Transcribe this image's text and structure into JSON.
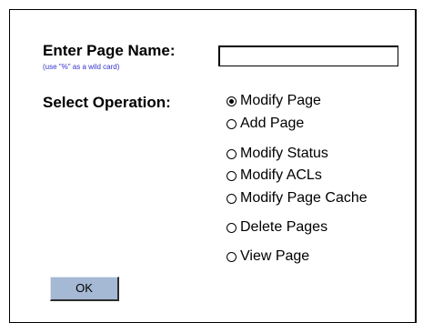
{
  "form": {
    "page_name_label": "Enter Page Name:",
    "wildcard_hint": "(use \"%\" as a wild card)",
    "page_name_value": "",
    "operation_label": "Select Operation:",
    "operations": [
      {
        "label": "Modify Page",
        "checked": true
      },
      {
        "label": "Add Page",
        "checked": false
      },
      {
        "label": "Modify Status",
        "checked": false
      },
      {
        "label": "Modify ACLs",
        "checked": false
      },
      {
        "label": "Modify Page Cache",
        "checked": false
      },
      {
        "label": "Delete Pages",
        "checked": false
      },
      {
        "label": "View Page",
        "checked": false
      }
    ],
    "ok_label": "OK"
  },
  "colors": {
    "button_face": "#a5b8d4",
    "hint_text": "#3333cc"
  }
}
